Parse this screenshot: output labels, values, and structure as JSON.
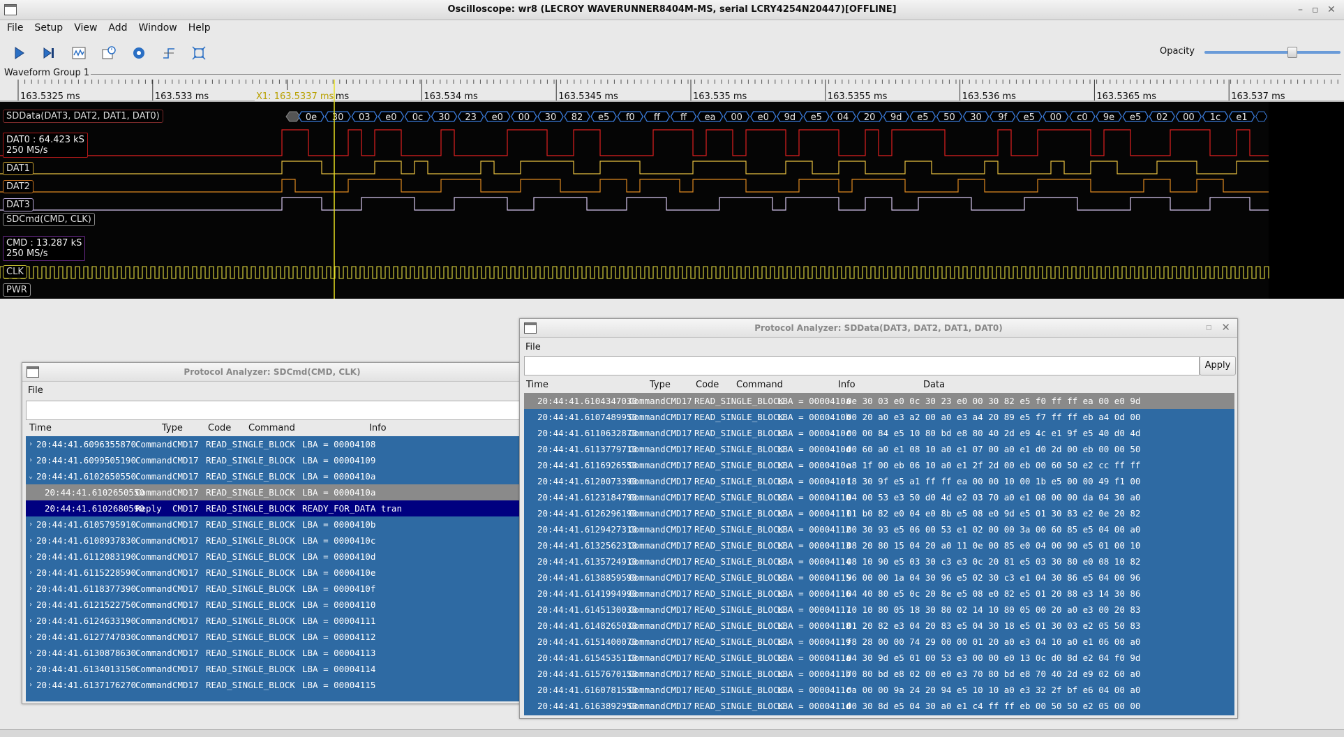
{
  "window": {
    "title": "Oscilloscope: wr8 (LECROY WAVERUNNER8404M-MS, serial LCRY4254N20447)[OFFLINE]"
  },
  "menubar": [
    "File",
    "Setup",
    "View",
    "Add",
    "Window",
    "Help"
  ],
  "toolbar": {
    "icons": [
      "play-icon",
      "step-icon",
      "waveform-icon",
      "history-icon",
      "settings-icon",
      "trigger-icon",
      "fit-icon"
    ],
    "opacity_label": "Opacity",
    "opacity_value": 0.8
  },
  "waveform_group": {
    "title": "Waveform Group 1",
    "time_ticks": [
      "163.5325 ms",
      "163.533 ms",
      "163.5335 ms",
      "163.534 ms",
      "163.5345 ms",
      "163.535 ms",
      "163.5355 ms",
      "163.536 ms",
      "163.5365 ms",
      "163.537 ms"
    ],
    "cursor_label": "X1: 163.5337 ms",
    "sddata_label": "SDData(DAT3, DAT2, DAT1, DAT0)",
    "sddata_bytes": [
      "0e",
      "30",
      "03",
      "e0",
      "0c",
      "30",
      "23",
      "e0",
      "00",
      "30",
      "82",
      "e5",
      "f0",
      "ff",
      "ff",
      "ea",
      "00",
      "e0",
      "9d",
      "e5",
      "04",
      "20",
      "9d",
      "e5",
      "50",
      "30",
      "9f",
      "e5",
      "00",
      "c0",
      "9e",
      "e5",
      "02",
      "00",
      "1c",
      "e1"
    ],
    "dat0_stat_line1": "DAT0 : 64.423 kS",
    "dat0_stat_line2": "250 MS/s",
    "channels": [
      "DAT1",
      "DAT2",
      "DAT3"
    ],
    "sdcmd_label": "SDCmd(CMD, CLK)",
    "cmd_stat_line1": "CMD : 13.287 kS",
    "cmd_stat_line2": "250 MS/s",
    "clk_label": "CLK",
    "pwr_label": "PWR",
    "colors": {
      "dat0": "#e02020",
      "dat1": "#e8c040",
      "dat2": "#e08a20",
      "dat3": "#d8c8f0",
      "clk": "#e8e040",
      "cursor": "#e8e020",
      "decode": "#3a7ad8"
    }
  },
  "pa_cmd": {
    "title": "Protocol Analyzer: SDCmd(CMD, CLK)",
    "menu": "File",
    "columns": [
      "Time",
      "Type",
      "Code",
      "Command",
      "Info"
    ],
    "rows": [
      {
        "arrow": "›",
        "time": "20:44:41.6096355870",
        "type": "Command",
        "code": "CMD17",
        "command": "READ_SINGLE_BLOCK",
        "info": "LBA = 00004108",
        "style": ""
      },
      {
        "arrow": "›",
        "time": "20:44:41.6099505190",
        "type": "Command",
        "code": "CMD17",
        "command": "READ_SINGLE_BLOCK",
        "info": "LBA = 00004109",
        "style": ""
      },
      {
        "arrow": "⌄",
        "time": "20:44:41.6102650550",
        "type": "Command",
        "code": "CMD17",
        "command": "READ_SINGLE_BLOCK",
        "info": "LBA = 0000410a",
        "style": ""
      },
      {
        "arrow": "",
        "time": "20:44:41.6102650550",
        "type": "Command",
        "code": "CMD17",
        "command": "READ_SINGLE_BLOCK",
        "info": "LBA = 0000410a",
        "style": "grey"
      },
      {
        "arrow": "",
        "time": "20:44:41.6102680590",
        "type": "Reply",
        "code": "CMD17",
        "command": "READ_SINGLE_BLOCK",
        "info": "READY_FOR_DATA tran",
        "style": "navy"
      },
      {
        "arrow": "›",
        "time": "20:44:41.6105795910",
        "type": "Command",
        "code": "CMD17",
        "command": "READ_SINGLE_BLOCK",
        "info": "LBA = 0000410b",
        "style": ""
      },
      {
        "arrow": "›",
        "time": "20:44:41.6108937830",
        "type": "Command",
        "code": "CMD17",
        "command": "READ_SINGLE_BLOCK",
        "info": "LBA = 0000410c",
        "style": ""
      },
      {
        "arrow": "›",
        "time": "20:44:41.6112083190",
        "type": "Command",
        "code": "CMD17",
        "command": "READ_SINGLE_BLOCK",
        "info": "LBA = 0000410d",
        "style": ""
      },
      {
        "arrow": "›",
        "time": "20:44:41.6115228590",
        "type": "Command",
        "code": "CMD17",
        "command": "READ_SINGLE_BLOCK",
        "info": "LBA = 0000410e",
        "style": ""
      },
      {
        "arrow": "›",
        "time": "20:44:41.6118377390",
        "type": "Command",
        "code": "CMD17",
        "command": "READ_SINGLE_BLOCK",
        "info": "LBA = 0000410f",
        "style": ""
      },
      {
        "arrow": "›",
        "time": "20:44:41.6121522750",
        "type": "Command",
        "code": "CMD17",
        "command": "READ_SINGLE_BLOCK",
        "info": "LBA = 00004110",
        "style": ""
      },
      {
        "arrow": "›",
        "time": "20:44:41.6124633190",
        "type": "Command",
        "code": "CMD17",
        "command": "READ_SINGLE_BLOCK",
        "info": "LBA = 00004111",
        "style": ""
      },
      {
        "arrow": "›",
        "time": "20:44:41.6127747030",
        "type": "Command",
        "code": "CMD17",
        "command": "READ_SINGLE_BLOCK",
        "info": "LBA = 00004112",
        "style": ""
      },
      {
        "arrow": "›",
        "time": "20:44:41.6130878630",
        "type": "Command",
        "code": "CMD17",
        "command": "READ_SINGLE_BLOCK",
        "info": "LBA = 00004113",
        "style": ""
      },
      {
        "arrow": "›",
        "time": "20:44:41.6134013150",
        "type": "Command",
        "code": "CMD17",
        "command": "READ_SINGLE_BLOCK",
        "info": "LBA = 00004114",
        "style": ""
      },
      {
        "arrow": "›",
        "time": "20:44:41.6137176270",
        "type": "Command",
        "code": "CMD17",
        "command": "READ_SINGLE_BLOCK",
        "info": "LBA = 00004115",
        "style": ""
      }
    ]
  },
  "pa_data": {
    "title": "Protocol Analyzer: SDData(DAT3, DAT2, DAT1, DAT0)",
    "menu": "File",
    "apply_label": "Apply",
    "filter_value": "",
    "columns": [
      "Time",
      "Type",
      "Code",
      "Command",
      "Info",
      "Data"
    ],
    "rows": [
      {
        "time": "20:44:41.6104347030",
        "type": "Command",
        "code": "CMD17",
        "command": "READ_SINGLE_BLOCK",
        "info": "LBA = 0000410a",
        "data": "0e 30 03 e0 0c 30 23 e0 00 30 82 e5 f0 ff ff ea 00 e0 9d",
        "style": "grey"
      },
      {
        "time": "20:44:41.6107489950",
        "type": "Command",
        "code": "CMD17",
        "command": "READ_SINGLE_BLOCK",
        "info": "LBA = 0000410b",
        "data": "00 20 a0 e3 a2 00 a0 e3 a4 20 89 e5 f7 ff ff eb a4 0d 00",
        "style": ""
      },
      {
        "time": "20:44:41.6110632870",
        "type": "Command",
        "code": "CMD17",
        "command": "READ_SINGLE_BLOCK",
        "info": "LBA = 0000410c",
        "data": "00 00 84 e5 10 80 bd e8 80 40 2d e9 4c e1 9f e5 40 d0 4d",
        "style": ""
      },
      {
        "time": "20:44:41.6113779710",
        "type": "Command",
        "code": "CMD17",
        "command": "READ_SINGLE_BLOCK",
        "info": "LBA = 0000410d",
        "data": "00 60 a0 e1 08 10 a0 e1 07 00 a0 e1 d0 2d 00 eb 00 00 50",
        "style": ""
      },
      {
        "time": "20:44:41.6116926550",
        "type": "Command",
        "code": "CMD17",
        "command": "READ_SINGLE_BLOCK",
        "info": "LBA = 0000410e",
        "data": "a8 1f 00 eb 06 10 a0 e1 2f 2d 00 eb 00 60 50 e2 cc ff ff",
        "style": ""
      },
      {
        "time": "20:44:41.6120073390",
        "type": "Command",
        "code": "CMD17",
        "command": "READ_SINGLE_BLOCK",
        "info": "LBA = 0000410f",
        "data": "18 30 9f e5 a1 ff ff ea 00 00 10 00 1b e5 00 00 49 f1 00",
        "style": ""
      },
      {
        "time": "20:44:41.6123184790",
        "type": "Command",
        "code": "CMD17",
        "command": "READ_SINGLE_BLOCK",
        "info": "LBA = 00004110",
        "data": "04 00 53 e3 50 d0 4d e2 03 70 a0 e1 08 00 00 da 04 30 a0",
        "style": ""
      },
      {
        "time": "20:44:41.6126296190",
        "type": "Command",
        "code": "CMD17",
        "command": "READ_SINGLE_BLOCK",
        "info": "LBA = 00004111",
        "data": "01 b0 82 e0 04 e0 8b e5 08 e0 9d e5 01 30 83 e2 0e 20 82",
        "style": ""
      },
      {
        "time": "20:44:41.6129427310",
        "type": "Command",
        "code": "CMD17",
        "command": "READ_SINGLE_BLOCK",
        "info": "LBA = 00004112",
        "data": "00 30 93 e5 06 00 53 e1 02 00 00 3a 00 60 85 e5 04 00 a0",
        "style": ""
      },
      {
        "time": "20:44:41.6132562310",
        "type": "Command",
        "code": "CMD17",
        "command": "READ_SINGLE_BLOCK",
        "info": "LBA = 00004113",
        "data": "08 20 80 15 04 20 a0 11 0e 00 85 e0 04 00 90 e5 01 00 10",
        "style": ""
      },
      {
        "time": "20:44:41.6135724910",
        "type": "Command",
        "code": "CMD17",
        "command": "READ_SINGLE_BLOCK",
        "info": "LBA = 00004114",
        "data": "08 10 90 e5 03 30 c3 e3 0c 20 81 e5 03 30 80 e0 08 10 82",
        "style": ""
      },
      {
        "time": "20:44:41.6138859590",
        "type": "Command",
        "code": "CMD17",
        "command": "READ_SINGLE_BLOCK",
        "info": "LBA = 00004115",
        "data": "96 00 00 1a 04 30 96 e5 02 30 c3 e1 04 30 86 e5 04 00 96",
        "style": ""
      },
      {
        "time": "20:44:41.6141994990",
        "type": "Command",
        "code": "CMD17",
        "command": "READ_SINGLE_BLOCK",
        "info": "LBA = 00004116",
        "data": "04 40 80 e5 0c 20 8e e5 08 e0 82 e5 01 20 88 e3 14 30 86",
        "style": ""
      },
      {
        "time": "20:44:41.6145130030",
        "type": "Command",
        "code": "CMD17",
        "command": "READ_SINGLE_BLOCK",
        "info": "LBA = 00004117",
        "data": "10 10 80 05 18 30 80 02 14 10 80 05 00 20 a0 e3 00 20 83",
        "style": ""
      },
      {
        "time": "20:44:41.6148265030",
        "type": "Command",
        "code": "CMD17",
        "command": "READ_SINGLE_BLOCK",
        "info": "LBA = 00004118",
        "data": "01 20 82 e3 04 20 83 e5 04 30 18 e5 01 30 03 e2 05 50 83",
        "style": ""
      },
      {
        "time": "20:44:41.6151400070",
        "type": "Command",
        "code": "CMD17",
        "command": "READ_SINGLE_BLOCK",
        "info": "LBA = 00004119",
        "data": "f8 28 00 00 74 29 00 00 01 20 a0 e3 04 10 a0 e1 06 00 a0",
        "style": ""
      },
      {
        "time": "20:44:41.6154535110",
        "type": "Command",
        "code": "CMD17",
        "command": "READ_SINGLE_BLOCK",
        "info": "LBA = 0000411a",
        "data": "04 30 9d e5 01 00 53 e3 00 00 e0 13 0c d0 8d e2 04 f0 9d",
        "style": ""
      },
      {
        "time": "20:44:41.6157670150",
        "type": "Command",
        "code": "CMD17",
        "command": "READ_SINGLE_BLOCK",
        "info": "LBA = 0000411b",
        "data": "70 80 bd e8 02 00 e0 e3 70 80 bd e8 70 40 2d e9 02 60 a0",
        "style": ""
      },
      {
        "time": "20:44:41.6160781550",
        "type": "Command",
        "code": "CMD17",
        "command": "READ_SINGLE_BLOCK",
        "info": "LBA = 0000411c",
        "data": "0a 00 00 9a 24 20 94 e5 10 10 a0 e3 32 2f bf e6 04 00 a0",
        "style": ""
      },
      {
        "time": "20:44:41.6163892950",
        "type": "Command",
        "code": "CMD17",
        "command": "READ_SINGLE_BLOCK",
        "info": "LBA = 0000411d",
        "data": "00 30 8d e5 04 30 a0 e1 c4 ff ff eb 00 50 50 e2 05 00 00",
        "style": ""
      }
    ]
  }
}
